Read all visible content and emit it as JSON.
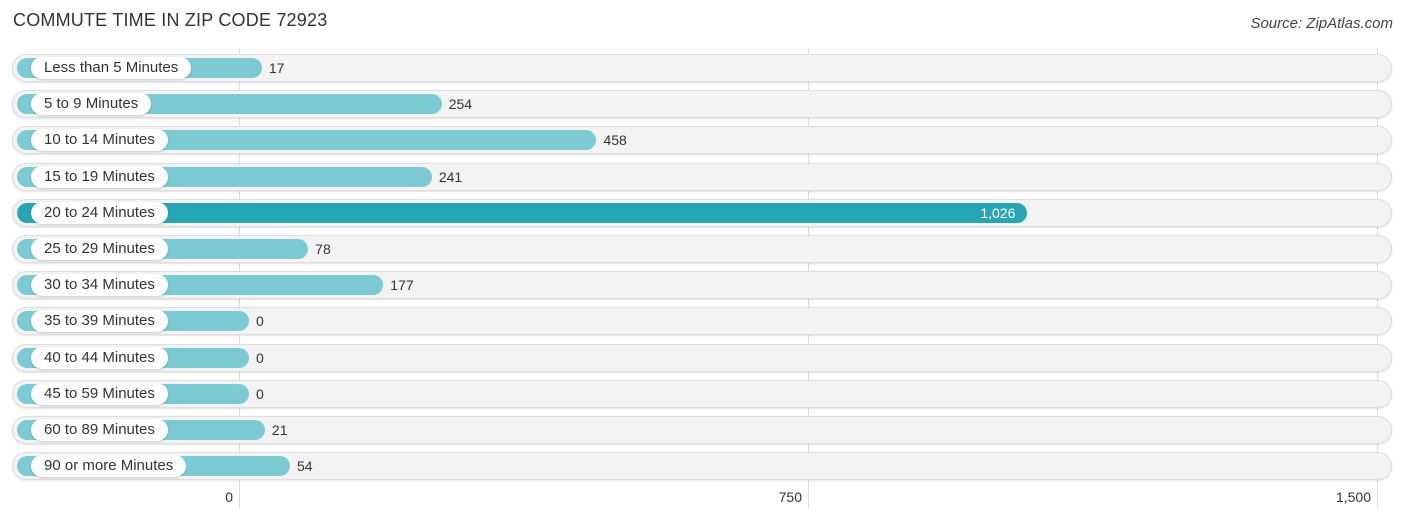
{
  "title": "COMMUTE TIME IN ZIP CODE 72923",
  "source": "Source: ZipAtlas.com",
  "colors": {
    "bar": "#7ccad4",
    "highlight": "#26a5b5",
    "track": "#f3f3f3"
  },
  "chart_data": {
    "type": "bar",
    "orientation": "horizontal",
    "title": "COMMUTE TIME IN ZIP CODE 72923",
    "xlabel": "",
    "ylabel": "",
    "xlim": [
      0,
      1500
    ],
    "grid": true,
    "categories": [
      "Less than 5 Minutes",
      "5 to 9 Minutes",
      "10 to 14 Minutes",
      "15 to 19 Minutes",
      "20 to 24 Minutes",
      "25 to 29 Minutes",
      "30 to 34 Minutes",
      "35 to 39 Minutes",
      "40 to 44 Minutes",
      "45 to 59 Minutes",
      "60 to 89 Minutes",
      "90 or more Minutes"
    ],
    "values": [
      17,
      254,
      458,
      241,
      1026,
      78,
      177,
      0,
      0,
      0,
      21,
      54
    ],
    "value_labels": [
      "17",
      "254",
      "458",
      "241",
      "1,026",
      "78",
      "177",
      "0",
      "0",
      "0",
      "21",
      "54"
    ],
    "highlight_index": 4,
    "ticks": [
      0,
      750,
      1500
    ],
    "tick_labels": [
      "0",
      "750",
      "1,500"
    ]
  }
}
